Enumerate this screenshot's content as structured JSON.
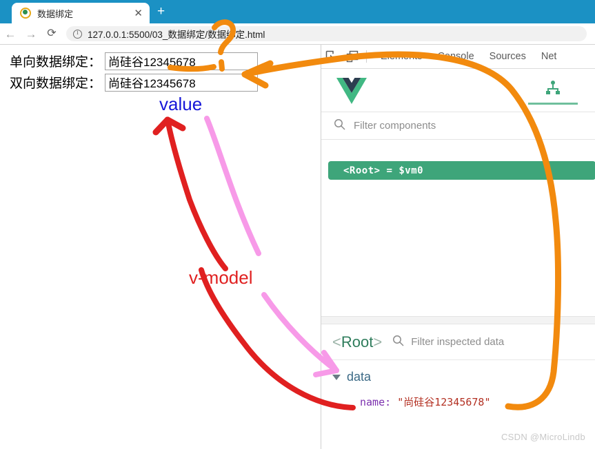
{
  "browser": {
    "tab": {
      "title": "数据绑定",
      "favicon": "vue-favicon-icon",
      "close_label": "✕"
    },
    "new_tab_label": "+",
    "nav": {
      "back": "←",
      "forward": "→",
      "reload": "⟳"
    },
    "omnibox": {
      "url": "127.0.0.1:5500/03_数据绑定/数据绑定.html",
      "info_icon": "site-info-icon"
    },
    "tabstrip_color": "#1b91c4"
  },
  "page": {
    "fields": [
      {
        "label": "单向数据绑定：",
        "value": "尚硅谷12345678"
      },
      {
        "label": "双向数据绑定：",
        "value": "尚硅谷12345678"
      }
    ]
  },
  "devtools": {
    "toolbar": {
      "inspect_icon": "inspect-element-icon",
      "device_icon": "device-toolbar-icon",
      "tabs": [
        "Elements",
        "Console",
        "Sources",
        "Net"
      ]
    },
    "vue_panel": {
      "logo": "vue-logo-icon",
      "tree_tab_icon": "component-tree-icon",
      "filter_placeholder": "Filter components",
      "search_icon": "search-icon",
      "selected_component": "<Root> = $vm0",
      "accent_green": "#3ea57a"
    },
    "inspector": {
      "root_angle_open": "<",
      "root_word": "Root",
      "root_angle_close": ">",
      "search_icon": "search-icon",
      "filter_placeholder": "Filter inspected data",
      "data_key": "data",
      "name_key": "name:",
      "name_value": "\"尚硅谷12345678\""
    }
  },
  "annotations": {
    "value_label": "value",
    "vmodel_label": "v-model",
    "colors": {
      "orange": "#f28a0e",
      "red": "#e02020",
      "pink": "#f79ae8",
      "blue": "#1616d8"
    }
  },
  "watermark": "CSDN @MicroLindb"
}
